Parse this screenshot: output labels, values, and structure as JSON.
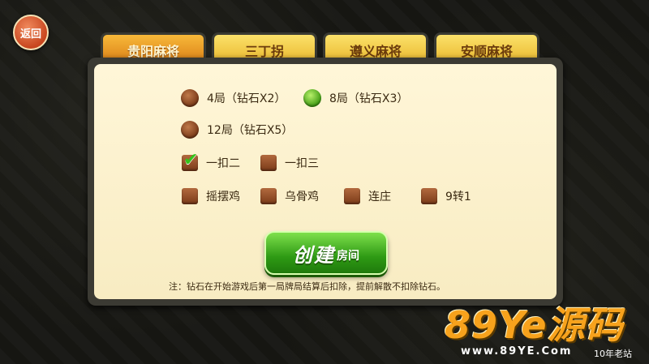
{
  "back_button": {
    "label": "返回"
  },
  "tabs": [
    {
      "label": "贵阳麻将",
      "active": true
    },
    {
      "label": "三丁拐",
      "active": false
    },
    {
      "label": "遵义麻将",
      "active": false
    },
    {
      "label": "安顺麻将",
      "active": false
    }
  ],
  "rounds": [
    {
      "label": "4局（钻石X2）",
      "selected": false
    },
    {
      "label": "8局（钻石X3）",
      "selected": true
    },
    {
      "label": "12局（钻石X5）",
      "selected": false
    }
  ],
  "options_row1": [
    {
      "label": "一扣二",
      "checked": true
    },
    {
      "label": "一扣三",
      "checked": false
    }
  ],
  "options_row2": [
    {
      "label": "摇摆鸡",
      "checked": false
    },
    {
      "label": "乌骨鸡",
      "checked": false
    },
    {
      "label": "连庄",
      "checked": false
    },
    {
      "label": "9转1",
      "checked": false
    }
  ],
  "create_button": {
    "label_big": "创建",
    "label_small": "房间"
  },
  "note": "注：钻石在开始游戏后第一局牌局结算后扣除，提前解散不扣除钻石。",
  "watermark": {
    "logo_latin": "89Ye",
    "logo_cn": "源码",
    "url": "www.89YE.Com",
    "tag": "10年老站"
  },
  "colors": {
    "tab_active": "#e08a1c",
    "tab_inactive": "#f3cb3c",
    "panel_bg": "#fbf1cc",
    "create_button": "#3fae1c"
  }
}
